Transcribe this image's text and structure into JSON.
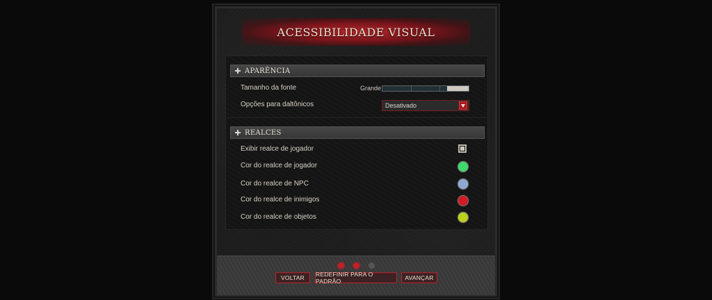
{
  "title": "ACESSIBILIDADE VISUAL",
  "sections": [
    {
      "header": "APARÊNCIA",
      "font_size": {
        "label": "Tamanho da fonte",
        "value_text": "Grande",
        "level": 0.75
      },
      "colorblind": {
        "label": "Opções para daltônicos",
        "value": "Desativado"
      }
    },
    {
      "header": "REALCES",
      "show_player_highlight": {
        "label": "Exibir realce de jogador",
        "checked": true
      },
      "colors": [
        {
          "label": "Cor do realce de jogador",
          "color": "#3fd86a"
        },
        {
          "label": "Cor do realce de NPC",
          "color": "#8ea8d6"
        },
        {
          "label": "Cor do realce de inimigos",
          "color": "#d21a22"
        },
        {
          "label": "Cor do realce de objetos",
          "color": "#bcd11c"
        }
      ]
    }
  ],
  "page_indicator": {
    "dots": [
      {
        "active": true,
        "color": "#c32028"
      },
      {
        "active": true,
        "color": "#c32028"
      },
      {
        "active": false,
        "color": "#555555"
      }
    ]
  },
  "buttons": {
    "back": "VOLTAR",
    "reset": "REDEFINIR PARA O PADRÃO",
    "next": "AVANÇAR"
  }
}
